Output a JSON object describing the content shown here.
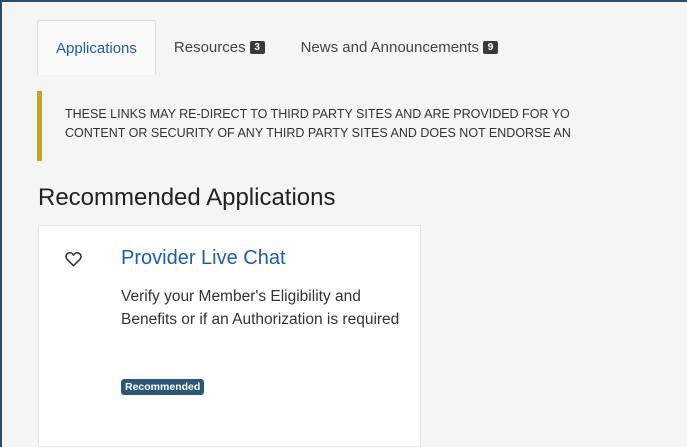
{
  "tabs": [
    {
      "label": "Applications",
      "badge": null,
      "active": true
    },
    {
      "label": "Resources",
      "badge": "3",
      "active": false
    },
    {
      "label": "News and Announcements",
      "badge": "9",
      "active": false
    }
  ],
  "alert": {
    "line1": "THESE LINKS MAY RE-DIRECT TO THIRD PARTY SITES AND ARE PROVIDED FOR YO",
    "line2": "CONTENT OR SECURITY OF ANY THIRD PARTY SITES AND DOES NOT ENDORSE AN",
    "accent_color": "#c8a227"
  },
  "section": {
    "title": "Recommended Applications"
  },
  "apps": [
    {
      "title": "Provider Live Chat",
      "description": "Verify your Member's Eligibility and Benefits or if an Authorization is required",
      "badge": "Recommended",
      "favorite_icon": "heart-outline-icon"
    }
  ],
  "colors": {
    "link": "#1f5ea8",
    "badge_dark": "#3a3a3a",
    "recommended_badge": "#2c5878",
    "frame": "#2e4a68"
  }
}
